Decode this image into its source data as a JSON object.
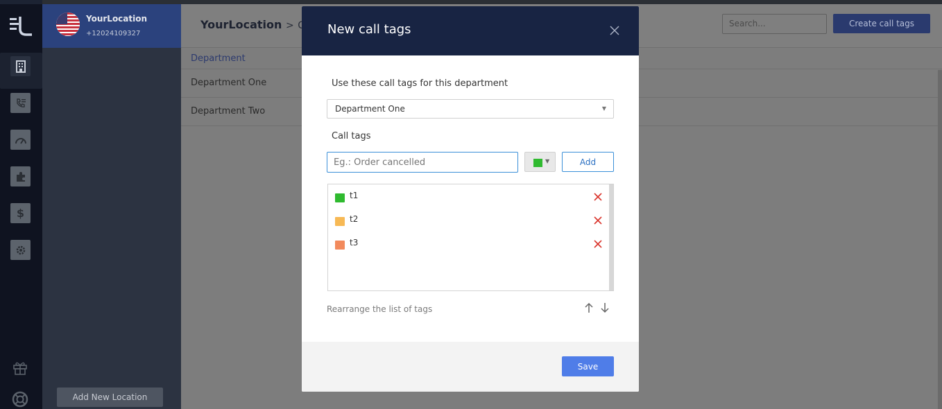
{
  "location": {
    "name": "YourLocation",
    "phone": "+12024109327"
  },
  "sidebar": {
    "add_location_label": "Add New Location"
  },
  "header": {
    "breadcrumb_root": "YourLocation",
    "breadcrumb_sep": ">",
    "breadcrumb_current": "Cal",
    "search_placeholder": "Search...",
    "create_label": "Create call tags"
  },
  "table": {
    "header": "Department",
    "rows": [
      "Department One",
      "Department Two"
    ]
  },
  "modal": {
    "title": "New call tags",
    "department_label": "Use these call tags for this department",
    "department_value": "Department One",
    "call_tags_label": "Call tags",
    "input_placeholder": "Eg.: Order cancelled",
    "selected_color": "#2fba2f",
    "add_label": "Add",
    "tags": [
      {
        "name": "t1",
        "color": "#2fba2f"
      },
      {
        "name": "t2",
        "color": "#f7b955"
      },
      {
        "name": "t3",
        "color": "#f28a5c"
      }
    ],
    "rearrange_label": "Rearrange the list of tags",
    "save_label": "Save"
  },
  "colors": {
    "accent": "#4f7de8",
    "modal_header": "#182443",
    "remove": "#d9342b"
  }
}
